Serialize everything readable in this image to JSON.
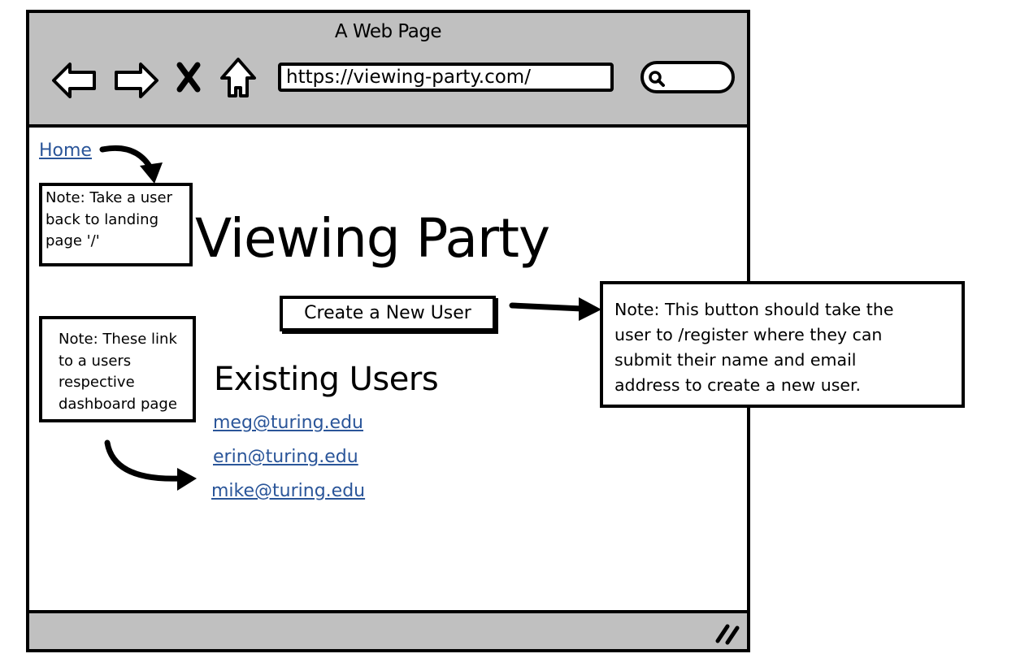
{
  "browser": {
    "window_title": "A Web Page",
    "url": "https://viewing-party.com/",
    "nav_icons": [
      "back-arrow-icon",
      "forward-arrow-icon",
      "stop-icon",
      "home-icon"
    ],
    "search_icon": "search-icon",
    "resize_icon": "resize-grip-icon"
  },
  "page": {
    "home_link": "Home",
    "title": "Viewing Party",
    "create_user_button": "Create a New User",
    "existing_users_heading": "Existing Users",
    "users": [
      {
        "email": "meg@turing.edu"
      },
      {
        "email": "erin@turing.edu"
      },
      {
        "email": "mike@turing.edu"
      }
    ]
  },
  "annotations": {
    "home_note": [
      "Note: Take a user",
      "back to landing",
      "page '/'"
    ],
    "users_note": [
      "Note: These link",
      "to a users",
      "respective",
      "dashboard page"
    ],
    "button_note": [
      "Note: This button should take the",
      "user to /register where they can",
      "submit their name and email",
      "address to create a new user."
    ]
  },
  "colors": {
    "chrome_gray": "#c0c0c0",
    "link_blue": "#2a5599",
    "outline": "#000000"
  }
}
